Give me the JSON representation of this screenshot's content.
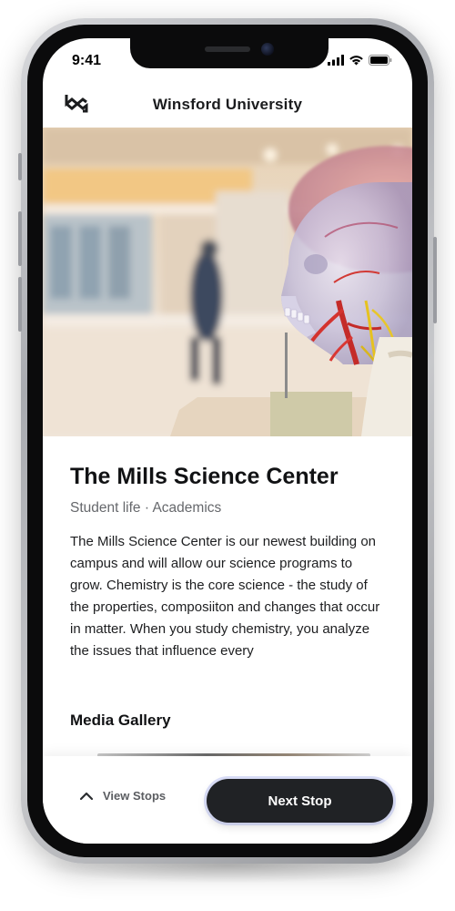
{
  "status_bar": {
    "time": "9:41"
  },
  "header": {
    "title": "Winsford University"
  },
  "place": {
    "title": "The Mills Science Center",
    "tags": "Student life · Academics",
    "description": "The Mills Science Center is our newest building on campus and will allow our science programs to grow. Chemistry is the core science - the study of the properties, composiiton and changes that occur in matter. When you study chemistry, you analyze the issues that influence every"
  },
  "media_gallery": {
    "title": "Media Gallery"
  },
  "bottom_bar": {
    "view_stops_label": "View Stops",
    "next_stop_label": "Next Stop"
  }
}
